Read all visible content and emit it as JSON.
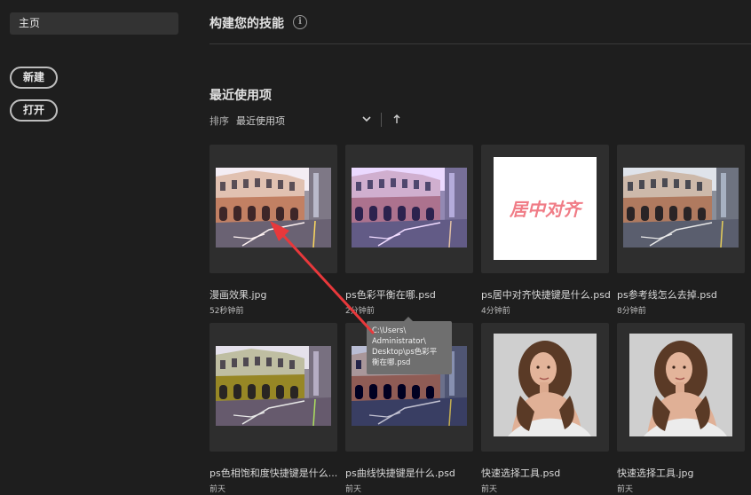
{
  "sidebar": {
    "home_label": "主页",
    "new_label": "新建",
    "open_label": "打开"
  },
  "main": {
    "skills_title": "构建您的技能",
    "info_glyph": "i",
    "recent_title": "最近使用项",
    "sort_label": "排序",
    "sort_value": "最近使用项"
  },
  "files": [
    {
      "name": "漫画效果.jpg",
      "time": "52秒钟前",
      "thumb": "street-comic"
    },
    {
      "name": "ps色彩平衡在哪.psd",
      "time": "2分钟前",
      "thumb": "street-purple"
    },
    {
      "name": "ps居中对齐快捷键是什么.psd",
      "time": "4分钟前",
      "thumb": "text-center"
    },
    {
      "name": "ps参考线怎么去掉.psd",
      "time": "8分钟前",
      "thumb": "street"
    },
    {
      "name": "ps色相饱和度快捷键是什么...",
      "time": "前天",
      "thumb": "street-hue"
    },
    {
      "name": "ps曲线快捷键是什么.psd",
      "time": "前天",
      "thumb": "street-dark"
    },
    {
      "name": "快速选择工具.psd",
      "time": "前天",
      "thumb": "portrait"
    },
    {
      "name": "快速选择工具.jpg",
      "time": "前天",
      "thumb": "portrait"
    }
  ],
  "thumb_text": "居中对齐",
  "tooltip": {
    "line1": "C:\\Users\\",
    "line2": "Administrator\\",
    "line3": "Desktop\\ps色彩平",
    "line4": "衡在哪.psd"
  },
  "colors": {
    "background": "#1e1e1e",
    "card": "#2e2e2e",
    "annotation_arrow": "#e8383b",
    "thumb_text": "#f07c86"
  }
}
